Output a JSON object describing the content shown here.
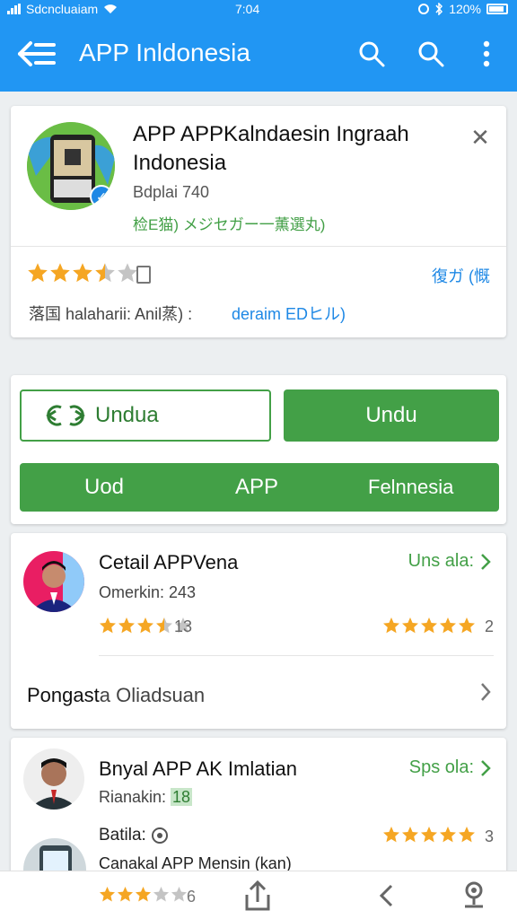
{
  "status_bar": {
    "carrier": "Sdcncluaiam",
    "time": "7:04",
    "battery": "120%"
  },
  "app_bar": {
    "title": "APP Inldonesia",
    "icons": [
      "back-menu-icon",
      "search-icon",
      "search-icon",
      "more-vert-icon"
    ]
  },
  "app_card": {
    "name": "APP APPKalndaesin Ingraah Indonesia",
    "developer": "Bdplai 740",
    "tagline": "检E猫) メジセガー一薫選丸)",
    "rating_stars": 3.5,
    "rating_link": "復ガ (慨",
    "meta_text": "落国 halaharii: Anil蒸) :",
    "meta_link": "deraim EDヒル)"
  },
  "actions": {
    "outline_button": "Undua",
    "green_button": "Undu",
    "wide_button": {
      "left": "Uod",
      "center": "APP",
      "right": "Felnnesia"
    }
  },
  "reviews": [
    {
      "name": "Cetail APPVena",
      "sub": "Omerkin: 243",
      "right_link": "Uns ala:",
      "left_stars": 3.5,
      "left_count": "13",
      "right_stars": 5,
      "right_count": "2"
    },
    {
      "name": "Bnyal APP AK Imlatian",
      "sub": "Rianakin: ",
      "sub_highlight": "18",
      "right_link": "Sps ola:",
      "detail_label": "Batila:",
      "right_stars": 5,
      "right_count": "3",
      "extra_line": "Canakal APP Mensin (kan)",
      "bottom_stars": 3,
      "bottom_count": "6"
    }
  ],
  "footer_row": {
    "label_dark": "Pongast",
    "label_rest": "a Oliadsuan"
  },
  "bottom_nav": {
    "icons": [
      "share-icon",
      "chevron-left-icon",
      "location-pin-icon"
    ]
  },
  "colors": {
    "primary": "#2196f3",
    "green": "#43a047",
    "star": "#f5a623",
    "link_blue": "#1e88e5"
  }
}
